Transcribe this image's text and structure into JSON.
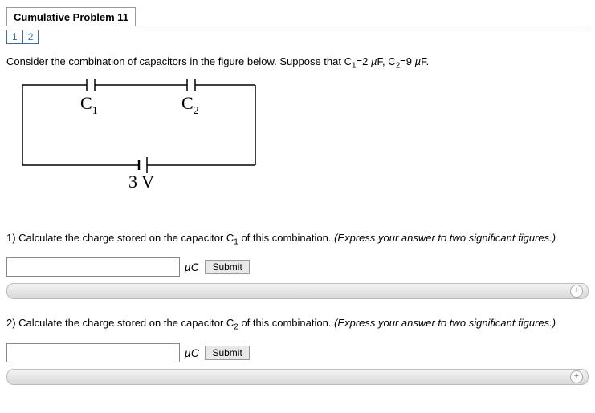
{
  "header": {
    "title": "Cumulative Problem 11",
    "tabs": [
      "1",
      "2"
    ]
  },
  "intro": {
    "prefix": "Consider the combination of capacitors in the figure below. Suppose that C",
    "sub1": "1",
    "mid1": "=2 ",
    "unit1": "µ",
    "mid2": "F, C",
    "sub2": "2",
    "mid3": "=9 ",
    "unit2": "µ",
    "suffix": "F."
  },
  "circuit": {
    "c1_label": "C",
    "c1_sub": "1",
    "c2_label": "C",
    "c2_sub": "2",
    "v_label": "3 V"
  },
  "q1": {
    "num": "1) ",
    "text_a": "Calculate the charge stored on the capacitor C",
    "sub": "1",
    "text_b": " of this combination. ",
    "hint": "(Express your answer to two significant figures.)",
    "unit": "µC",
    "submit": "Submit",
    "expand": "+"
  },
  "q2": {
    "num": "2) ",
    "text_a": "Calculate the charge stored on the capacitor C",
    "sub": "2",
    "text_b": " of this combination. ",
    "hint": "(Express your answer to two significant figures.)",
    "unit": "µC",
    "submit": "Submit",
    "expand": "+"
  }
}
